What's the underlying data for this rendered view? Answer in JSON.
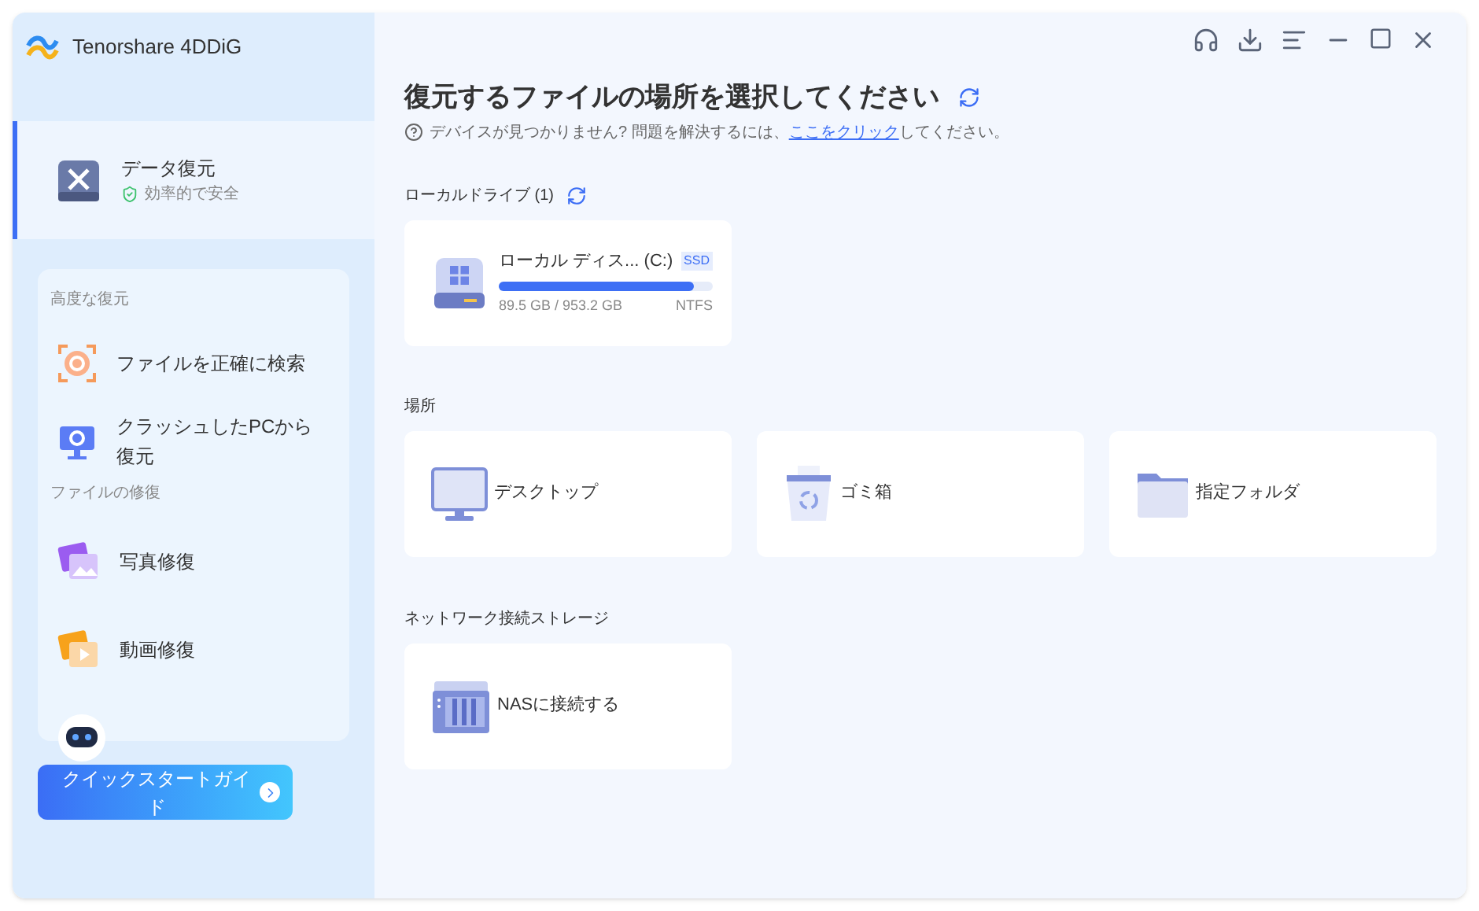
{
  "app": {
    "name": "Tenorshare 4DDiG"
  },
  "sidebar": {
    "main_item": {
      "label": "データ復元",
      "subtitle": "効率的で安全",
      "selected": true
    },
    "groups": [
      {
        "title": "高度な復元",
        "items": [
          {
            "label": "ファイルを正確に検索",
            "kind": "target"
          },
          {
            "label": "クラッシュしたPCから復元",
            "kind": "pc"
          }
        ]
      },
      {
        "title": "ファイルの修復",
        "items": [
          {
            "label": "写真修復",
            "kind": "photo"
          },
          {
            "label": "動画修復",
            "kind": "video"
          }
        ]
      }
    ],
    "guide_button": "クイックスタートガイド"
  },
  "main": {
    "title": "復元するファイルの場所を選択してください",
    "help": {
      "before": "デバイスが見つかりません? 問題を解決するには、",
      "link": "ここをクリック",
      "after": "してください。"
    },
    "local_drives": {
      "title": "ローカルドライブ (1)",
      "drives": [
        {
          "name": "ローカル ディス... (C:)",
          "badge": "SSD",
          "level": 0.91,
          "usage": "89.5 GB / 953.2 GB",
          "fs": "NTFS"
        }
      ]
    },
    "locations": {
      "title": "場所",
      "items": [
        {
          "label": "デスクトップ",
          "kind": "desktop"
        },
        {
          "label": "ゴミ箱",
          "kind": "trash"
        },
        {
          "label": "指定フォルダ",
          "kind": "folder"
        }
      ]
    },
    "network": {
      "title": "ネットワーク接続ストレージ",
      "items": [
        {
          "label": "NASに接続する",
          "kind": "nas"
        }
      ]
    }
  }
}
